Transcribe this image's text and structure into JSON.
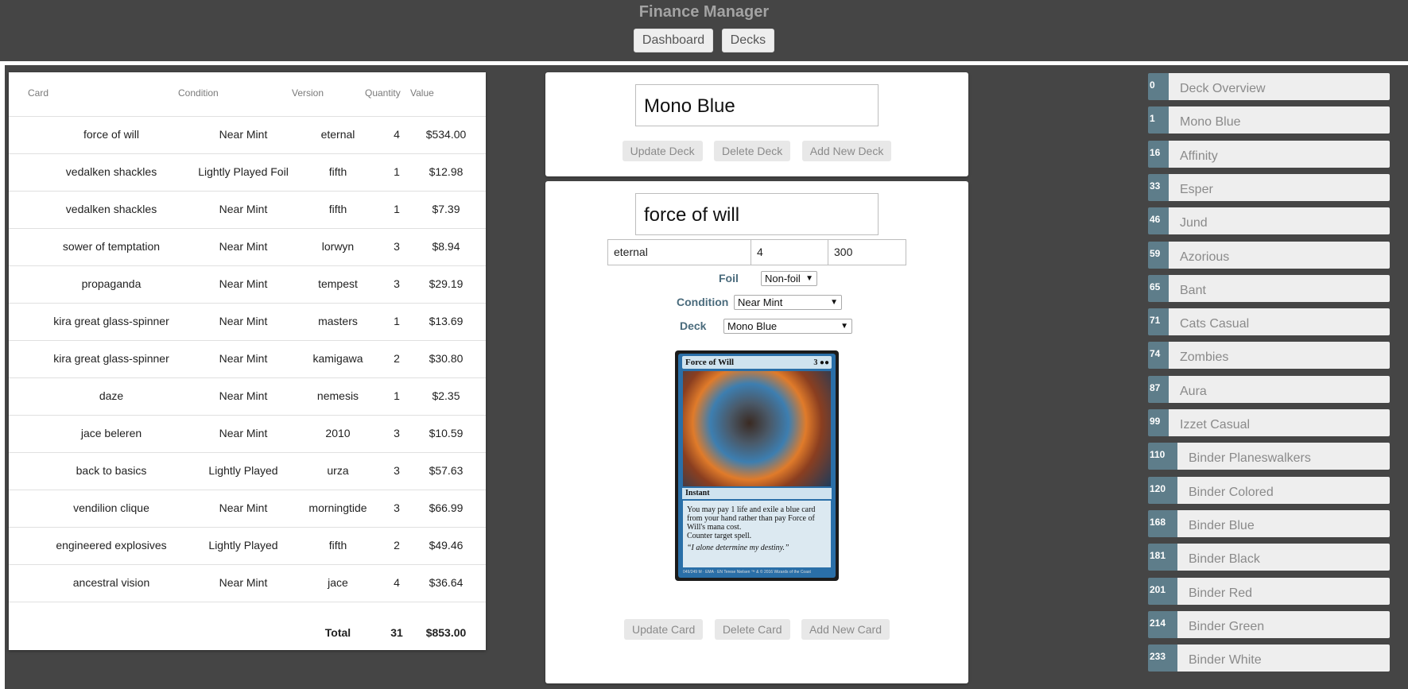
{
  "app_title": "Finance Manager",
  "nav": {
    "dashboard": "Dashboard",
    "decks": "Decks"
  },
  "table": {
    "headers": {
      "card": "Card",
      "condition": "Condition",
      "version": "Version",
      "quantity": "Quantity",
      "value": "Value"
    },
    "rows": [
      {
        "card": "force of will",
        "condition": "Near Mint",
        "version": "eternal",
        "quantity": "4",
        "value": "$534.00"
      },
      {
        "card": "vedalken shackles",
        "condition": "Lightly Played Foil",
        "version": "fifth",
        "quantity": "1",
        "value": "$12.98"
      },
      {
        "card": "vedalken shackles",
        "condition": "Near Mint",
        "version": "fifth",
        "quantity": "1",
        "value": "$7.39"
      },
      {
        "card": "sower of temptation",
        "condition": "Near Mint",
        "version": "lorwyn",
        "quantity": "3",
        "value": "$8.94"
      },
      {
        "card": "propaganda",
        "condition": "Near Mint",
        "version": "tempest",
        "quantity": "3",
        "value": "$29.19"
      },
      {
        "card": "kira great glass-spinner",
        "condition": "Near Mint",
        "version": "masters",
        "quantity": "1",
        "value": "$13.69"
      },
      {
        "card": "kira great glass-spinner",
        "condition": "Near Mint",
        "version": "kamigawa",
        "quantity": "2",
        "value": "$30.80"
      },
      {
        "card": "daze",
        "condition": "Near Mint",
        "version": "nemesis",
        "quantity": "1",
        "value": "$2.35"
      },
      {
        "card": "jace beleren",
        "condition": "Near Mint",
        "version": "2010",
        "quantity": "3",
        "value": "$10.59"
      },
      {
        "card": "back to basics",
        "condition": "Lightly Played",
        "version": "urza",
        "quantity": "3",
        "value": "$57.63"
      },
      {
        "card": "vendilion clique",
        "condition": "Near Mint",
        "version": "morningtide",
        "quantity": "3",
        "value": "$66.99"
      },
      {
        "card": "engineered explosives",
        "condition": "Lightly Played",
        "version": "fifth",
        "quantity": "2",
        "value": "$49.46"
      },
      {
        "card": "ancestral vision",
        "condition": "Near Mint",
        "version": "jace",
        "quantity": "4",
        "value": "$36.64"
      }
    ],
    "total": {
      "label": "Total",
      "quantity": "31",
      "value": "$853.00"
    }
  },
  "deck_form": {
    "name_value": "Mono Blue",
    "update_label": "Update Deck",
    "delete_label": "Delete Deck",
    "add_label": "Add New Deck"
  },
  "card_form": {
    "name_value": "force of will",
    "version_value": "eternal",
    "quantity_value": "4",
    "price_value": "300",
    "foil_label": "Foil",
    "foil_selected": "Non-foil",
    "condition_label": "Condition",
    "condition_selected": "Near Mint",
    "deck_label": "Deck",
    "deck_selected": "Mono Blue",
    "update_label": "Update Card",
    "delete_label": "Delete Card",
    "add_label": "Add New Card"
  },
  "card_image": {
    "name": "Force of Will",
    "cost": "3 ●●",
    "type": "Instant",
    "text1": "You may pay 1 life and exile a blue card from your hand rather than pay Force of Will's mana cost.",
    "text2": "Counter target spell.",
    "flavor": "“I alone determine my destiny.”",
    "footer": "049/249 M · EMA · EN  Terese Nielsen   ™ & © 2016 Wizards of the Coast"
  },
  "decks": [
    {
      "id": "0",
      "name": "Deck Overview"
    },
    {
      "id": "1",
      "name": "Mono Blue"
    },
    {
      "id": "16",
      "name": "Affinity"
    },
    {
      "id": "33",
      "name": "Esper"
    },
    {
      "id": "46",
      "name": "Jund"
    },
    {
      "id": "59",
      "name": "Azorious"
    },
    {
      "id": "65",
      "name": "Bant"
    },
    {
      "id": "71",
      "name": "Cats Casual"
    },
    {
      "id": "74",
      "name": "Zombies"
    },
    {
      "id": "87",
      "name": "Aura"
    },
    {
      "id": "99",
      "name": "Izzet Casual"
    },
    {
      "id": "110",
      "name": "Binder Planeswalkers"
    },
    {
      "id": "120",
      "name": "Binder Colored"
    },
    {
      "id": "168",
      "name": "Binder Blue"
    },
    {
      "id": "181",
      "name": "Binder Black"
    },
    {
      "id": "201",
      "name": "Binder Red"
    },
    {
      "id": "214",
      "name": "Binder Green"
    },
    {
      "id": "233",
      "name": "Binder White"
    }
  ]
}
